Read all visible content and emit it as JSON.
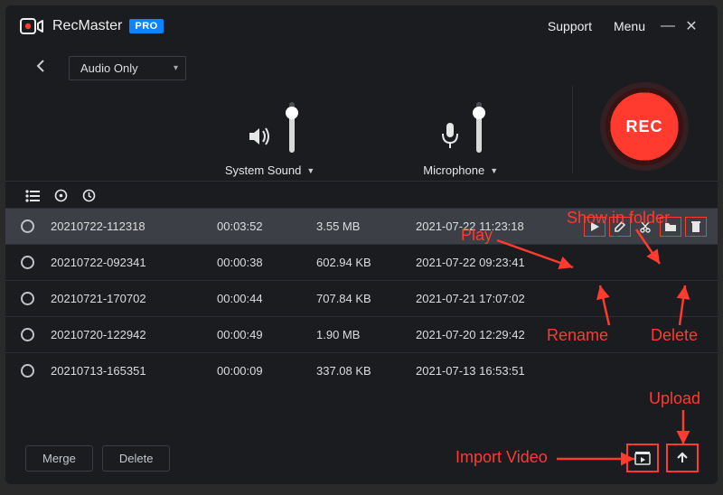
{
  "app": {
    "title": "RecMaster",
    "badge": "PRO"
  },
  "header": {
    "support": "Support",
    "menu": "Menu"
  },
  "mode_selector": {
    "value": "Audio Only"
  },
  "audio": {
    "system": {
      "label": "System Sound",
      "level_pct": 78
    },
    "mic": {
      "label": "Microphone",
      "level_pct": 78
    }
  },
  "rec_button": {
    "label": "REC"
  },
  "recordings": [
    {
      "name": "20210722-112318",
      "duration": "00:03:52",
      "size": "3.55 MB",
      "datetime": "2021-07-22 11:23:18",
      "selected": true
    },
    {
      "name": "20210722-092341",
      "duration": "00:00:38",
      "size": "602.94 KB",
      "datetime": "2021-07-22 09:23:41",
      "selected": false
    },
    {
      "name": "20210721-170702",
      "duration": "00:00:44",
      "size": "707.84 KB",
      "datetime": "2021-07-21 17:07:02",
      "selected": false
    },
    {
      "name": "20210720-122942",
      "duration": "00:00:49",
      "size": "1.90 MB",
      "datetime": "2021-07-20 12:29:42",
      "selected": false
    },
    {
      "name": "20210713-165351",
      "duration": "00:00:09",
      "size": "337.08 KB",
      "datetime": "2021-07-13 16:53:51",
      "selected": false
    }
  ],
  "footer": {
    "merge": "Merge",
    "delete": "Delete"
  },
  "annotations": {
    "play": "Play",
    "rename": "Rename",
    "show_in_folder": "Show in folder",
    "delete": "Delete",
    "import_video": "Import Video",
    "upload": "Upload"
  }
}
